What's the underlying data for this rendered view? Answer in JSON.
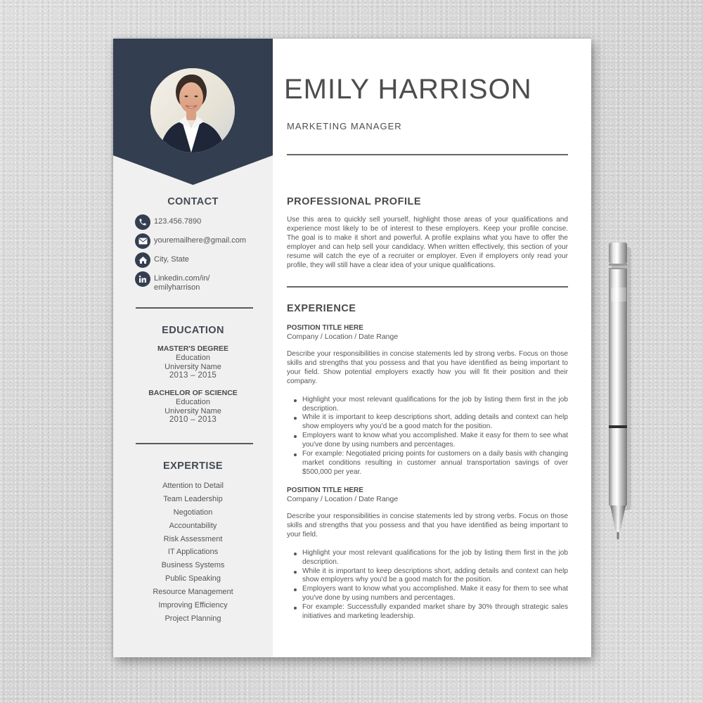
{
  "resume": {
    "name": "EMILY HARRISON",
    "job_title": "MARKETING MANAGER",
    "colors": {
      "accent": "#333e50",
      "sidebar_bg": "#f0f0f0",
      "text": "#555555",
      "heading": "#4a4a4a"
    },
    "photo": {
      "icon": "profile-photo",
      "alt": "Portrait of a smiling woman in a white shirt and dark blazer"
    },
    "sidebar": {
      "contact": {
        "title": "CONTACT",
        "items": [
          {
            "icon": "phone-icon",
            "text": "123.456.7890"
          },
          {
            "icon": "envelope-icon",
            "text": "youremailhere@gmail.com"
          },
          {
            "icon": "home-icon",
            "text": "City, State"
          },
          {
            "icon": "linkedin-icon",
            "line1": "Linkedin.com/in/",
            "line2": "emilyharrison"
          }
        ]
      },
      "education": {
        "title": "EDUCATION",
        "items": [
          {
            "degree": "MASTER'S DEGREE",
            "field": "Education",
            "school": "University Name",
            "years": "2013 – 2015"
          },
          {
            "degree": "BACHELOR OF SCIENCE",
            "field": "Education",
            "school": "University Name",
            "years": "2010 – 2013"
          }
        ]
      },
      "expertise": {
        "title": "EXPERTISE",
        "items": [
          "Attention to Detail",
          "Team Leadership",
          "Negotiation",
          "Accountability",
          "Risk Assessment",
          "IT Applications",
          "Business Systems",
          "Public Speaking",
          "Resource Management",
          "Improving Efficiency",
          "Project Planning"
        ]
      }
    },
    "profile": {
      "title": "PROFESSIONAL PROFILE",
      "text": "Use this area to quickly sell yourself, highlight those areas of your qualifications and experience most likely to be of interest to these employers. Keep your profile concise. The goal is to make it short and powerful. A profile explains what you have to offer the employer and can help sell your candidacy. When written effectively, this section of your resume will catch the eye of a recruiter or employer. Even if employers only read your profile, they will still have a clear idea of your unique qualifications."
    },
    "experience": {
      "title": "EXPERIENCE",
      "jobs": [
        {
          "position": "POSITION TITLE HERE",
          "meta": "Company / Location / Date Range",
          "description": "Describe your responsibilities in concise statements led by strong verbs. Focus on those skills and strengths that you possess and that you have identified as being important to your field. Show potential employers exactly how you will fit their position and their company.",
          "bullets": [
            "Highlight your most relevant qualifications for the job by listing them first in the job description.",
            "While it is important to keep descriptions short, adding details and context can help show employers why you'd be a good match for the position.",
            "Employers want to know what you accomplished. Make it easy for them to see what you've done by using numbers and percentages.",
            "For example: Negotiated pricing points for customers on a daily basis with changing market conditions resulting in customer annual transportation savings of over $500,000 per year."
          ]
        },
        {
          "position": "POSITION TITLE HERE",
          "meta": "Company / Location / Date Range",
          "description": "Describe your responsibilities in concise statements led by strong verbs. Focus on those skills and strengths that you possess and that you have identified as being important to your field.",
          "bullets": [
            "Highlight your most relevant qualifications for the job by listing them first in the job description.",
            "While it is important to keep descriptions short, adding details and context can help show employers why you'd be a good match for the position.",
            "Employers want to know what you accomplished. Make it easy for them to see what you've done by using numbers and percentages.",
            "For example: Successfully expanded market share by 30% through strategic sales initiatives and marketing leadership."
          ]
        }
      ]
    }
  },
  "scene": {
    "background": "textured-gray-surface",
    "props": [
      "silver-pen"
    ]
  }
}
